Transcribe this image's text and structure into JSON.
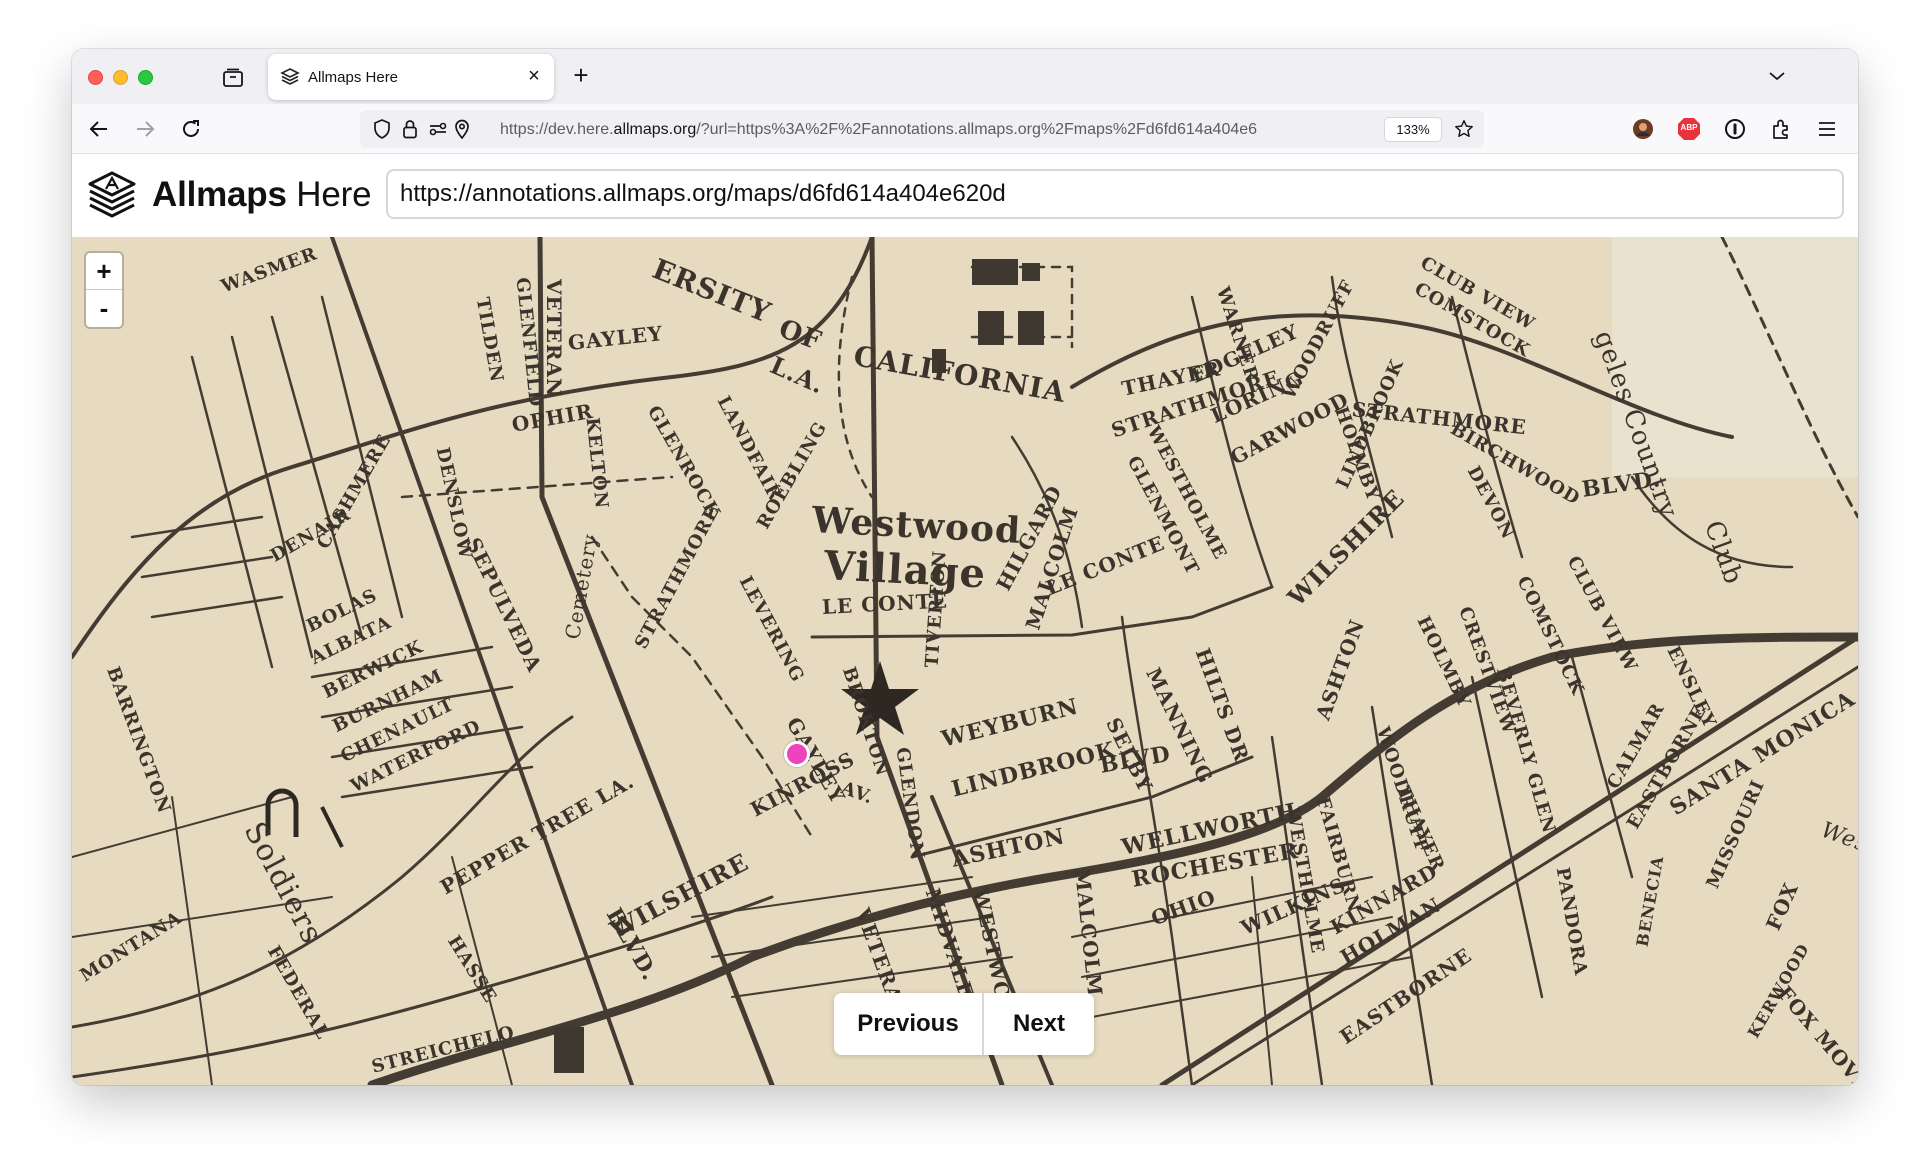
{
  "browser": {
    "tab_title": "Allmaps Here",
    "url_prefix": "https://dev.here.",
    "url_host": "allmaps.org",
    "url_rest": "/?url=https%3A%2F%2Fannotations.allmaps.org%2Fmaps%2Fd6fd614a404e6",
    "zoom": "133%",
    "extension_abp": "ABP"
  },
  "app": {
    "brand_bold": "Allmaps",
    "brand_light": "Here",
    "annotation_url": "https://annotations.allmaps.org/maps/d6fd614a404e620d"
  },
  "map": {
    "zoom_in": "+",
    "zoom_out": "-",
    "labels": {
      "westwood": "Westwood",
      "village": "Village",
      "california": "CALIFORNIA",
      "of": "OF",
      "la": "L.A.",
      "ersity": "ERSITY",
      "le_conte": "LE CONTE",
      "le_conte_2": "LE CONTE",
      "wilshire": "WILSHIRE",
      "wilshire_2": "WILSHIRE",
      "lindbrook": "LINDBROOK",
      "blvd": "BLVD",
      "blvd_2": "BLVD.",
      "blvd_3": "BLVD.",
      "weyburn": "WEYBURN",
      "gayley": "GAYLEY",
      "gayley_2": "GAYLEY",
      "kinross": "KINROSS",
      "ashton": "ASHTON",
      "ashton_2": "ASHTON",
      "wellworth": "WELLWORTH",
      "rochester": "ROCHESTER",
      "wilkins": "WILKINS",
      "ohio": "OHIO",
      "holman": "HOLMAN",
      "kinnard": "KINNARD",
      "eastborne": "EASTBORNE",
      "veteran": "VETERAN",
      "veteran_top": "VETERAN",
      "midvale": "MIDVALE",
      "westwood_st": "WESTWOOD",
      "glenrock": "GLENROCK",
      "strathmore": "STRATHMORE",
      "strathmore_2": "STRATHMORE",
      "strathmore_3": "STRATHMORE",
      "levering": "LEVERING",
      "landfair": "LANDFAIR",
      "roebling": "ROEBLING",
      "hilgard": "HILGARD",
      "malcolm": "MALCOLM",
      "malcolm_2": "MALCOLM",
      "selby": "SELBY",
      "manning": "MANNING",
      "hilts": "HILTS DR",
      "glenmont": "GLENMONT",
      "westholme": "WESTHOLME",
      "westholme_2": "WESTHOLME",
      "thayer": "THAYER",
      "thayer_2": "THAYER",
      "edgeley": "EDGELEY",
      "loring": "LORING",
      "garwood": "GARWOOD",
      "woodruff": "WOODRUFF",
      "woodruff_2": "WOODRUFF",
      "holmby": "HOLMBY",
      "holmby_2": "HOLMBY",
      "warner": "WARNER",
      "lindbrook_2": "LINDBROOK",
      "comstock": "COMSTOCK",
      "comstock_2": "COMSTOCK",
      "club_view": "CLUB VIEW",
      "club_view_2": "CLUB VIEW",
      "birchwood": "BIRCHWOOD",
      "devon": "DEVON",
      "crestview": "CRESTVIEW",
      "beverly_glen": "BEVERLY GLEN",
      "pandora": "PANDORA",
      "calmar": "CALMAR",
      "eastborne_2": "EASTBORNE",
      "santa_monica": "SANTA MONICA",
      "missouri": "MISSOURI",
      "fox": "FOX",
      "country": "geles Country",
      "club": "Club",
      "soldiers": "Soldiers",
      "cemetery": "Cemetery",
      "sepulveda": "SEPULVEDA",
      "pepper_tree": "PEPPER TREE LA.",
      "waterford": "WATERFORD",
      "chenault": "CHENAULT",
      "burnham": "BURNHAM",
      "berwick": "BERWICK",
      "albata": "ALBATA",
      "bolas": "BOLAS",
      "cashmere": "CASHMERE",
      "denair": "DENAIR",
      "montana": "MONTANA",
      "barrington": "BARRINGTON",
      "federal": "FEDERAL",
      "hasse": "HASSE",
      "streichelo": "STREICHELO",
      "gayley_top": "GAYLEY",
      "kelton": "KELTON",
      "ophir": "OPHIR",
      "denslow": "DENSLOW",
      "wasmer": "WASMER",
      "tilden": "TILDEN",
      "glenfield": "GLENFIELD",
      "benecia": "BENECIA",
      "kerwood": "KERWOOD",
      "ensley": "ENSLEY",
      "fox_movie": "FOX MOVIE",
      "west": "West",
      "glendon": "GLENDON",
      "tiverton": "TIVERTON",
      "brokton": "BROKTON",
      "fairburn": "FAIRBURN",
      "av": "AV."
    }
  },
  "pager": {
    "previous": "Previous",
    "next": "Next"
  }
}
